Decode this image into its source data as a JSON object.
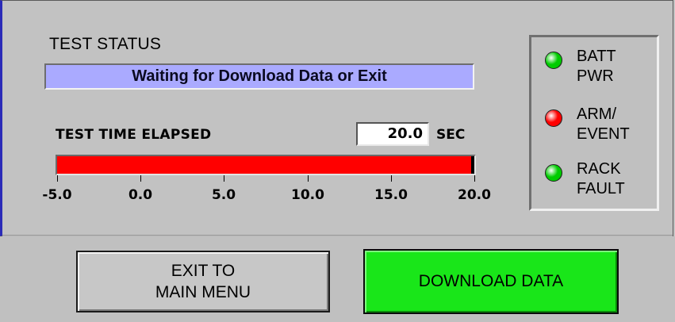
{
  "test_status": {
    "label": "TEST STATUS",
    "message": "Waiting for Download Data or Exit"
  },
  "elapsed": {
    "label": "TEST TIME ELAPSED",
    "value": "20.0",
    "unit": "SEC",
    "min": -5.0,
    "max": 20.0,
    "progress_value": 20.0,
    "ticks": [
      "-5.0",
      "0.0",
      "5.0",
      "10.0",
      "15.0",
      "20.0"
    ]
  },
  "indicators": [
    {
      "name": "batt-pwr",
      "label": "BATT\nPWR",
      "state": "on",
      "color": "#00cc00"
    },
    {
      "name": "arm-event",
      "label": "ARM/\nEVENT",
      "state": "on",
      "color": "#ff0000"
    },
    {
      "name": "rack-fault",
      "label": "RACK\nFAULT",
      "state": "on",
      "color": "#00cc00"
    }
  ],
  "buttons": {
    "exit_label": "EXIT TO\nMAIN MENU",
    "download_label": "DOWNLOAD DATA"
  },
  "colors": {
    "status_bg": "#aaaaff",
    "progress_fill": "#ff0000",
    "download_bg": "#19e619",
    "panel_bg": "#c2c2c2"
  }
}
